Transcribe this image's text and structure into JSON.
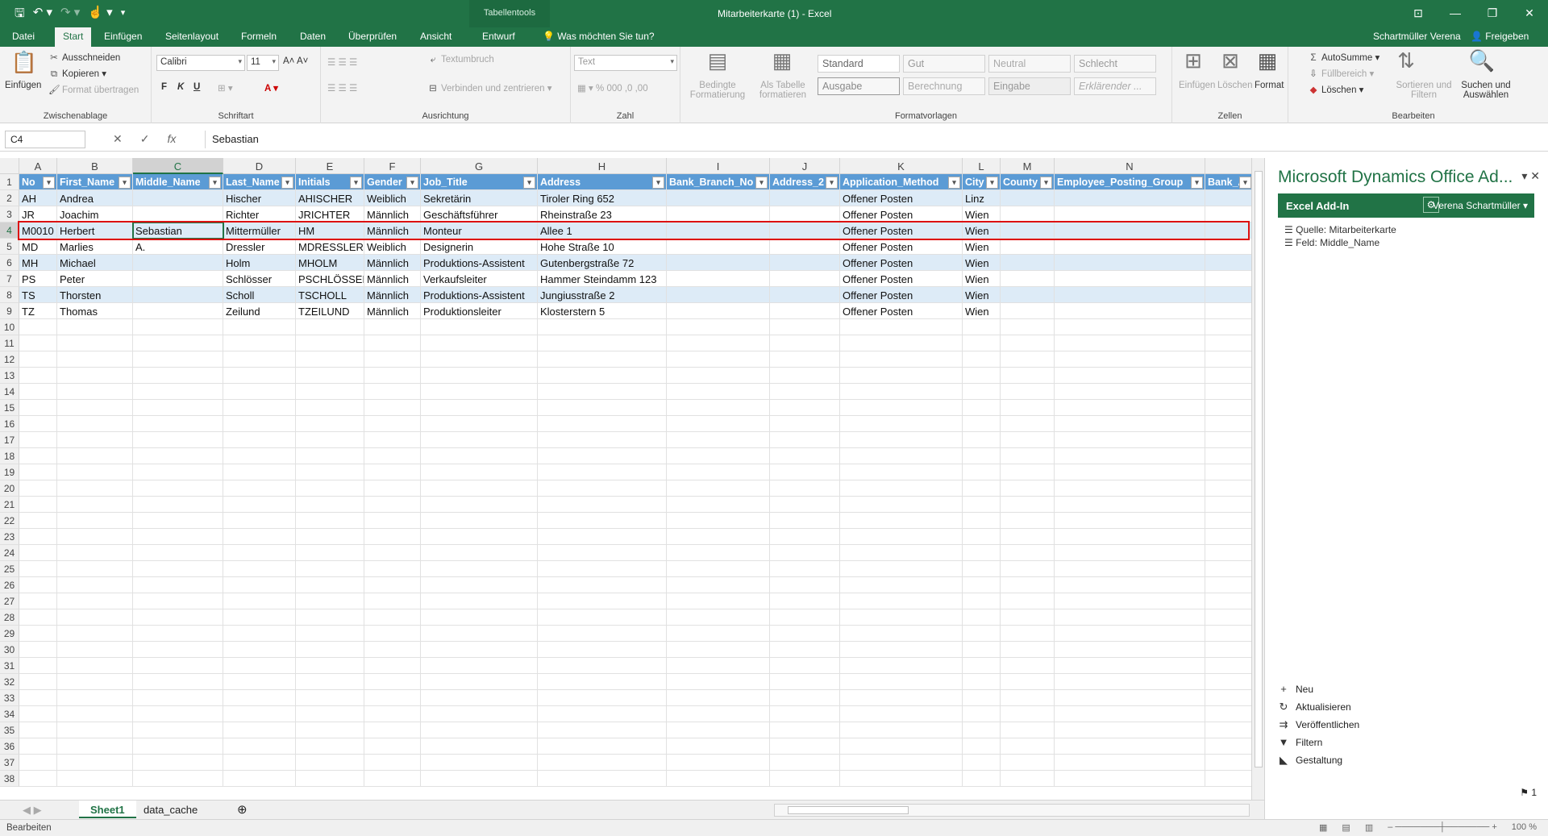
{
  "window": {
    "title": "Mitarbeiterkarte (1) - Excel",
    "context_tab_group": "Tabellentools",
    "user": "Schartmüller Verena",
    "share": "Freigeben"
  },
  "ribbon_tabs": [
    "Datei",
    "Start",
    "Einfügen",
    "Seitenlayout",
    "Formeln",
    "Daten",
    "Überprüfen",
    "Ansicht",
    "Entwurf"
  ],
  "tell_me": "Was möchten Sie tun?",
  "ribbon": {
    "clipboard": {
      "paste": "Einfügen",
      "cut": "Ausschneiden",
      "copy": "Kopieren",
      "format_painter": "Format übertragen",
      "group": "Zwischenablage"
    },
    "font": {
      "name": "Calibri",
      "size": "11",
      "bold": "F",
      "italic": "K",
      "underline": "U",
      "group": "Schriftart"
    },
    "alignment": {
      "wrap": "Textumbruch",
      "merge": "Verbinden und zentrieren",
      "group": "Ausrichtung"
    },
    "number": {
      "format": "Text",
      "group": "Zahl"
    },
    "styles": {
      "conditional": "Bedingte Formatierung",
      "as_table": "Als Tabelle formatieren",
      "standard": "Standard",
      "gut": "Gut",
      "neutral": "Neutral",
      "schlecht": "Schlecht",
      "ausgabe": "Ausgabe",
      "berechnung": "Berechnung",
      "eingabe": "Eingabe",
      "erklaerender": "Erklärender ...",
      "group": "Formatvorlagen"
    },
    "cells": {
      "insert": "Einfügen",
      "delete": "Löschen",
      "format": "Format",
      "group": "Zellen"
    },
    "editing": {
      "autosum": "AutoSumme",
      "fill": "Füllbereich",
      "clear": "Löschen",
      "sort": "Sortieren und Filtern",
      "find": "Suchen und Auswählen",
      "group": "Bearbeiten"
    }
  },
  "formula_bar": {
    "name_box": "C4",
    "formula": "Sebastian"
  },
  "columns": [
    "A",
    "B",
    "C",
    "D",
    "E",
    "F",
    "G",
    "H",
    "I",
    "J",
    "K",
    "L",
    "M",
    "N"
  ],
  "headers": [
    "No",
    "First_Name",
    "Middle_Name",
    "Last_Name",
    "Initials",
    "Gender",
    "Job_Title",
    "Address",
    "Bank_Branch_No",
    "Address_2",
    "Application_Method",
    "City",
    "County",
    "Employee_Posting_Group",
    "Bank_Ac"
  ],
  "rows": [
    [
      "AH",
      "Andrea",
      "",
      "Hischer",
      "AHISCHER",
      "Weiblich",
      "Sekretärin",
      "Tiroler Ring 652",
      "",
      "",
      "Offener Posten",
      "Linz",
      "",
      ""
    ],
    [
      "JR",
      "Joachim",
      "",
      "Richter",
      "JRICHTER",
      "Männlich",
      "Geschäftsführer",
      "Rheinstraße 23",
      "",
      "",
      "Offener Posten",
      "Wien",
      "",
      ""
    ],
    [
      "M0010",
      "Herbert",
      "Sebastian",
      "Mittermüller",
      "HM",
      "Männlich",
      "Monteur",
      "Allee 1",
      "",
      "",
      "Offener Posten",
      "Wien",
      "",
      ""
    ],
    [
      "MD",
      "Marlies",
      "A.",
      "Dressler",
      "MDRESSLER",
      "Weiblich",
      "Designerin",
      "Hohe Straße 10",
      "",
      "",
      "Offener Posten",
      "Wien",
      "",
      ""
    ],
    [
      "MH",
      "Michael",
      "",
      "Holm",
      "MHOLM",
      "Männlich",
      "Produktions-Assistent",
      "Gutenbergstraße 72",
      "",
      "",
      "Offener Posten",
      "Wien",
      "",
      ""
    ],
    [
      "PS",
      "Peter",
      "",
      "Schlösser",
      "PSCHLÖSSER",
      "Männlich",
      "Verkaufsleiter",
      "Hammer Steindamm 123",
      "",
      "",
      "Offener Posten",
      "Wien",
      "",
      ""
    ],
    [
      "TS",
      "Thorsten",
      "",
      "Scholl",
      "TSCHOLL",
      "Männlich",
      "Produktions-Assistent",
      "Jungiusstraße 2",
      "",
      "",
      "Offener Posten",
      "Wien",
      "",
      ""
    ],
    [
      "TZ",
      "Thomas",
      "",
      "Zeilund",
      "TZEILUND",
      "Männlich",
      "Produktionsleiter",
      "Klosterstern 5",
      "",
      "",
      "Offener Posten",
      "Wien",
      "",
      ""
    ]
  ],
  "sheet_tabs": [
    "Sheet1",
    "data_cache"
  ],
  "status": {
    "mode": "Bearbeiten",
    "zoom": "100 %"
  },
  "pane": {
    "title": "Microsoft Dynamics Office Ad...",
    "header": "Excel Add-In",
    "user": "Verena Schartmüller",
    "source": "Quelle: Mitarbeiterkarte",
    "field": "Feld: Middle_Name",
    "actions": [
      "Neu",
      "Aktualisieren",
      "Veröffentlichen",
      "Filtern",
      "Gestaltung"
    ],
    "page": "1"
  },
  "colors": {
    "accent": "#217346",
    "table_header": "#5b9bd5",
    "band": "#ddebf7",
    "highlight": "#dd1111"
  }
}
